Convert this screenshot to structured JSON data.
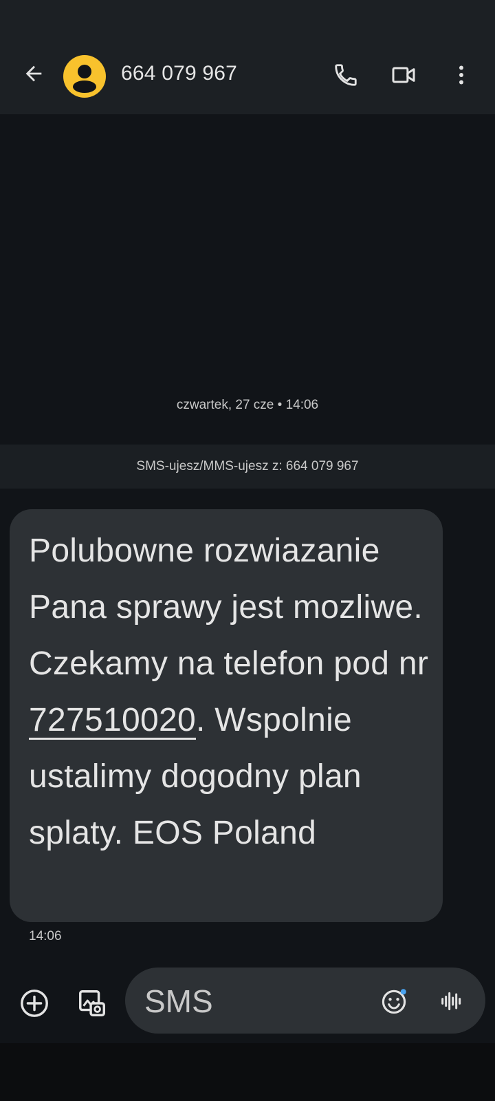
{
  "header": {
    "contact_number": "664 079 967"
  },
  "icons": {
    "back": "arrow-back-icon",
    "avatar": "person-icon",
    "call": "phone-icon",
    "video": "video-camera-icon",
    "more": "more-vert-icon",
    "add": "add-circle-icon",
    "gallery": "gallery-icon",
    "emoji": "emoji-icon",
    "voice": "voice-waveform-icon"
  },
  "conversation": {
    "date_label": "czwartek, 27 cze • 14:06",
    "info_text": "SMS-ujesz/MMS-ujesz z: 664 079 967",
    "message": {
      "text_part1": "Polubowne rozwiazanie Pana sprawy jest mozliwe. Czekamy na telefon pod nr ",
      "phone_link": "727510020",
      "text_part2": ". Wspolnie ustalimy dogodny plan splaty. EOS Poland",
      "time": "14:06"
    }
  },
  "composer": {
    "placeholder": "SMS"
  },
  "colors": {
    "background": "#111418",
    "topbar": "#1c2024",
    "bubble": "#2d3135",
    "avatar": "#f8c22d",
    "emoji_dot": "#4aa3f0"
  }
}
